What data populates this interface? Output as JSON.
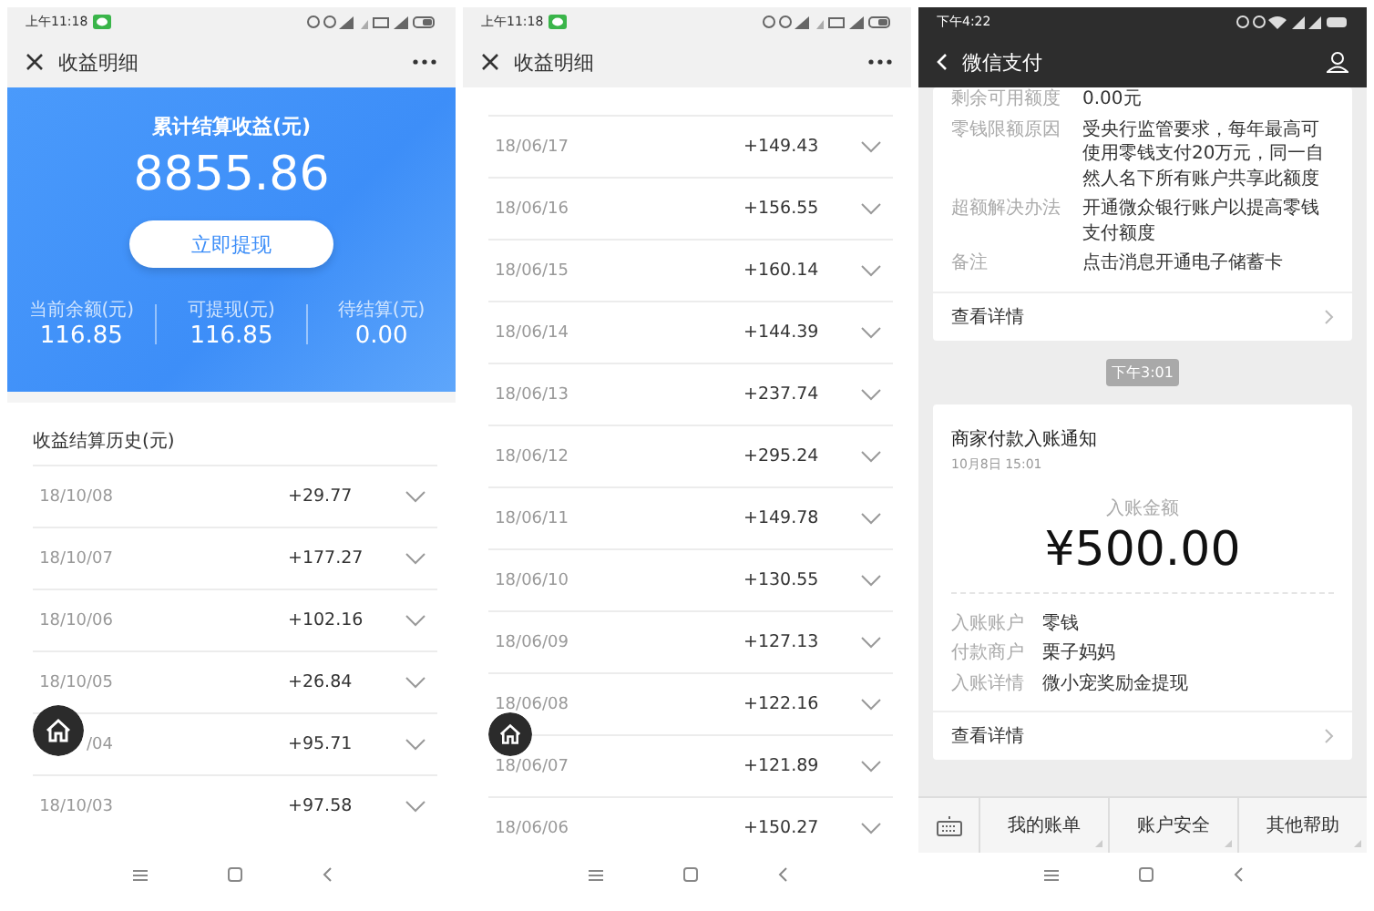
{
  "earnings_screen": {
    "status_time": "上午11:18",
    "title": "收益明细",
    "summary": {
      "label": "累计结算收益(元)",
      "total": "8855.86",
      "withdraw_button": "立即提现",
      "stats": [
        {
          "label": "当前余额(元)",
          "value": "116.85"
        },
        {
          "label": "可提现(元)",
          "value": "116.85"
        },
        {
          "label": "待结算(元)",
          "value": "0.00"
        }
      ]
    },
    "history_title": "收益结算历史(元)",
    "rows": [
      {
        "date": "18/10/08",
        "amount": "+29.77"
      },
      {
        "date": "18/10/07",
        "amount": "+177.27"
      },
      {
        "date": "18/10/06",
        "amount": "+102.16"
      },
      {
        "date": "18/10/05",
        "amount": "+26.84"
      },
      {
        "date": "/04",
        "amount": "+95.71"
      },
      {
        "date": "18/10/03",
        "amount": "+97.58"
      }
    ]
  },
  "history_screen": {
    "status_time": "上午11:18",
    "title": "收益明细",
    "rows": [
      {
        "date": "18/06/17",
        "amount": "+149.43"
      },
      {
        "date": "18/06/16",
        "amount": "+156.55"
      },
      {
        "date": "18/06/15",
        "amount": "+160.14"
      },
      {
        "date": "18/06/14",
        "amount": "+144.39"
      },
      {
        "date": "18/06/13",
        "amount": "+237.74"
      },
      {
        "date": "18/06/12",
        "amount": "+295.24"
      },
      {
        "date": "18/06/11",
        "amount": "+149.78"
      },
      {
        "date": "18/06/10",
        "amount": "+130.55"
      },
      {
        "date": "18/06/09",
        "amount": "+127.13"
      },
      {
        "date": "18/06/08",
        "amount": "+122.16"
      },
      {
        "date": "18/06/07",
        "amount": "+121.89"
      },
      {
        "date": "18/06/06",
        "amount": "+150.27"
      }
    ]
  },
  "payment_screen": {
    "status_time": "下午4:22",
    "title": "微信支付",
    "limit_card": {
      "fields": [
        {
          "label": "剩余可用额度",
          "value": "0.00元"
        },
        {
          "label": "零钱限额原因",
          "value": "受央行监管要求，每年最高可使用零钱支付20万元，同一自然人名下所有账户共享此额度"
        },
        {
          "label": "超额解决办法",
          "value": "开通微众银行账户以提高零钱支付额度"
        },
        {
          "label": "备注",
          "value": "点击消息开通电子储蓄卡"
        }
      ],
      "details_link": "查看详情"
    },
    "timestamp": "下午3:01",
    "notice_card": {
      "title": "商家付款入账通知",
      "date": "10月8日 15:01",
      "amount_label": "入账金额",
      "amount": "¥500.00",
      "fields": [
        {
          "label": "入账账户",
          "value": "零钱"
        },
        {
          "label": "付款商户",
          "value": "栗子妈妈"
        },
        {
          "label": "入账详情",
          "value": "微小宠奖励金提现"
        }
      ],
      "details_link": "查看详情"
    },
    "menu": [
      "我的账单",
      "账户安全",
      "其他帮助"
    ]
  }
}
